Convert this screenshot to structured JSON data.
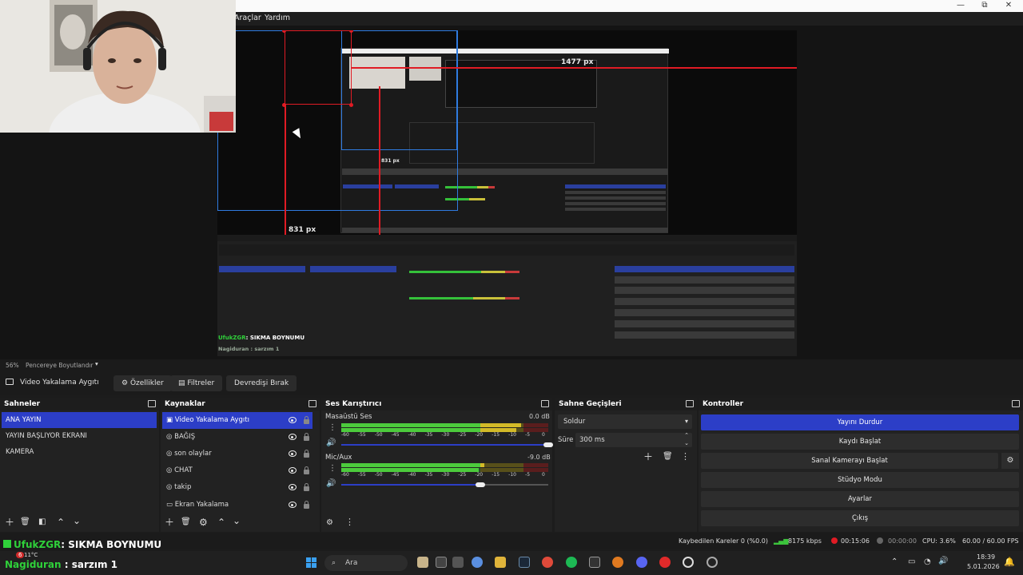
{
  "window": {
    "minimize": "—",
    "restore": "⧉",
    "close": "✕"
  },
  "menu": {
    "items": [
      "Araçlar",
      "Yardım"
    ]
  },
  "preview": {
    "label_width": "1477 px",
    "label_height": "831 px",
    "mini_label_height": "831 px",
    "mini_status": "Kaybedilen Kareler 0 (%0.0)   8175 kbps   00:15:06   CPU: 3.6%   60.00 / 60.00 FPS",
    "mini_chat_name": "UfukZGR",
    "mini_chat_msg": ": SIKMA BOYNUMU",
    "mini_chat2": "Nagiduran : sarzım 1"
  },
  "zoom": {
    "percent": "56%",
    "mode": "Pencereye Boyutlandır"
  },
  "source_toolbar": {
    "device": "Video Yakalama Aygıtı",
    "properties": "Özellikler",
    "filters": "Filtreler",
    "deactivate": "Devredişi Bırak"
  },
  "scenes": {
    "title": "Sahneler",
    "items": [
      "ANA YAYIN",
      "YAYIN BAŞLIYOR EKRANI",
      "KAMERA"
    ]
  },
  "sources": {
    "title": "Kaynaklar",
    "items": [
      "Video Yakalama Aygıtı",
      "BAĞIŞ",
      "son olaylar",
      "CHAT",
      "takip",
      "Ekran Yakalama"
    ]
  },
  "mixer": {
    "title": "Ses Karıştırıcı",
    "tracks": [
      {
        "name": "Masaüstü Ses",
        "db": "0.0 dB",
        "level": 0.87
      },
      {
        "name": "Mic/Aux",
        "db": "-9.0 dB",
        "level": 0.69
      }
    ],
    "ticks": [
      "-60",
      "-55",
      "-50",
      "-45",
      "-40",
      "-35",
      "-30",
      "-25",
      "-20",
      "-15",
      "-10",
      "-5",
      "0"
    ]
  },
  "transitions": {
    "title": "Sahne Geçişleri",
    "selected": "Soldur",
    "duration_label": "Süre",
    "duration": "300 ms"
  },
  "controls": {
    "title": "Kontroller",
    "buttons": [
      "Yayını Durdur",
      "Kaydı Başlat",
      "Sanal Kamerayı Başlat",
      "Stüdyo Modu",
      "Ayarlar",
      "Çıkış"
    ]
  },
  "status": {
    "dropped": "Kaybedilen Kareler 0 (%0.0)",
    "bitrate": "8175 kbps",
    "stream_time": "00:15:06",
    "rec_time": "00:00:00",
    "cpu": "CPU: 3.6%",
    "fps": "60.00 / 60.00 FPS"
  },
  "chat": {
    "line1_name": "UfukZGR",
    "line1_msg": ": SIKMA BOYNUMU",
    "line2_name": "Nagiduran",
    "line2_msg": ": sarzım 1",
    "badge": "6",
    "weather": "11°C"
  },
  "taskbar": {
    "search": "Ara",
    "time": "18:39",
    "date": "5.01.2026"
  },
  "colors": {
    "accent": "#2c3ec7",
    "bbox_red": "#e01b24",
    "bbox_blue": "#2f7be0",
    "chat_green": "#2fd13a"
  }
}
